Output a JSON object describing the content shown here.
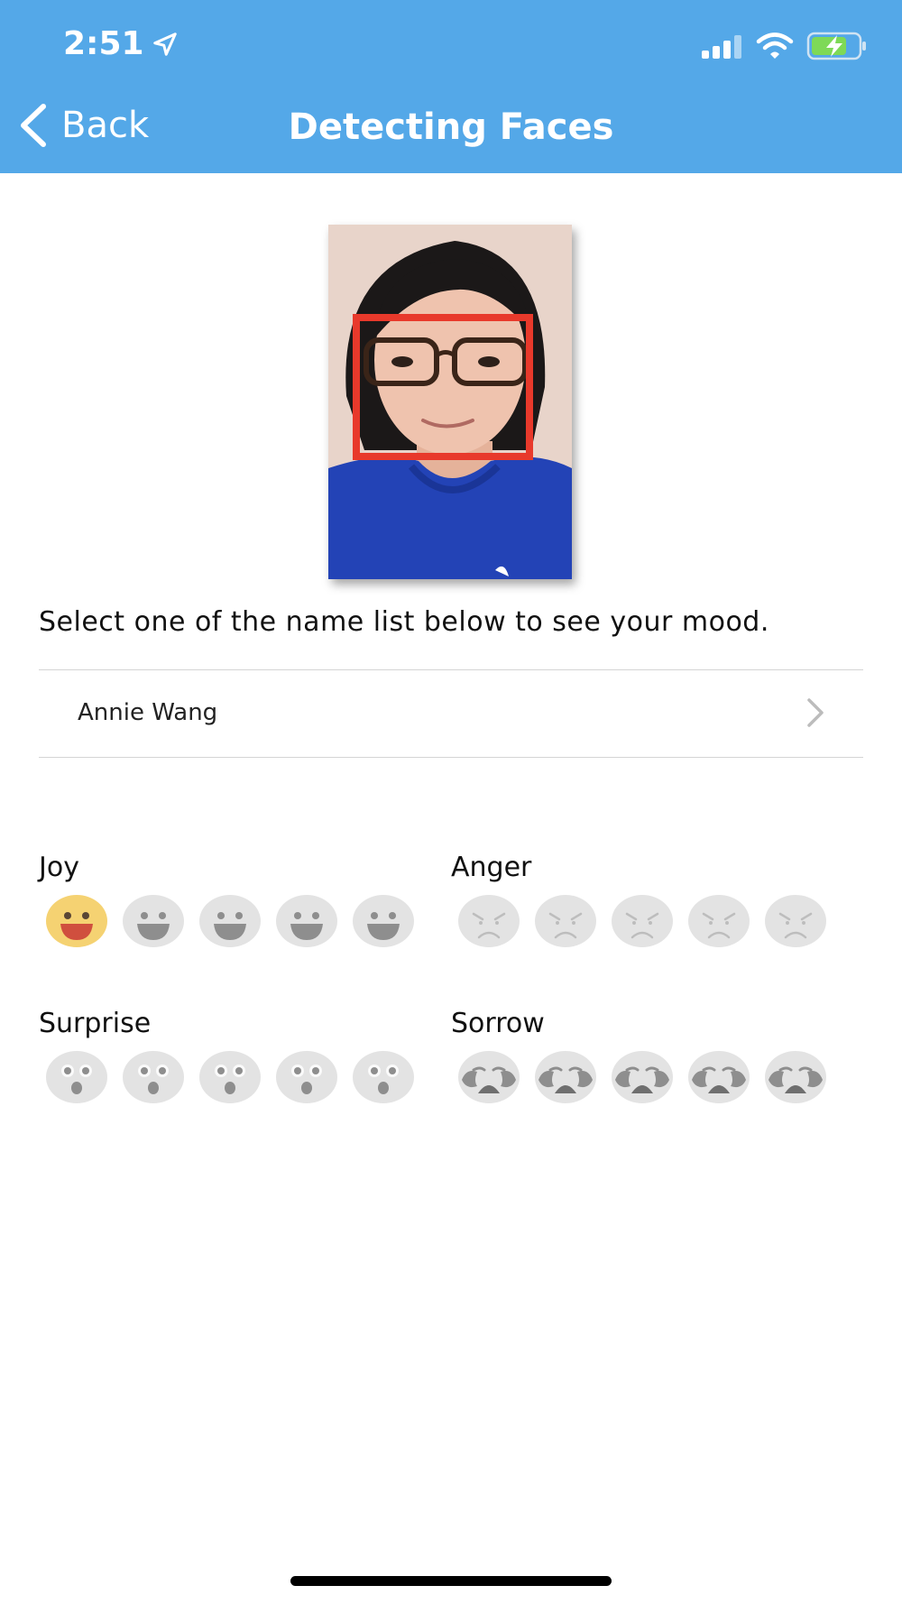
{
  "status_bar": {
    "time": "2:51"
  },
  "nav": {
    "back_label": "Back",
    "title": "Detecting Faces"
  },
  "instruction": "Select one of the name list below to see your mood.",
  "name_list": [
    {
      "name": "Annie Wang"
    }
  ],
  "moods": [
    {
      "label": "Joy",
      "icon": "joy-face-icon",
      "level": 1,
      "max": 5
    },
    {
      "label": "Anger",
      "icon": "anger-face-icon",
      "level": 0,
      "max": 5
    },
    {
      "label": "Surprise",
      "icon": "surprise-face-icon",
      "level": 0,
      "max": 5
    },
    {
      "label": "Sorrow",
      "icon": "sorrow-face-icon",
      "level": 0,
      "max": 5
    }
  ],
  "colors": {
    "header": "#54a8e8",
    "face_active": "#f5d272",
    "face_inactive": "#e3e3e3",
    "detection_box": "#e8392b"
  }
}
